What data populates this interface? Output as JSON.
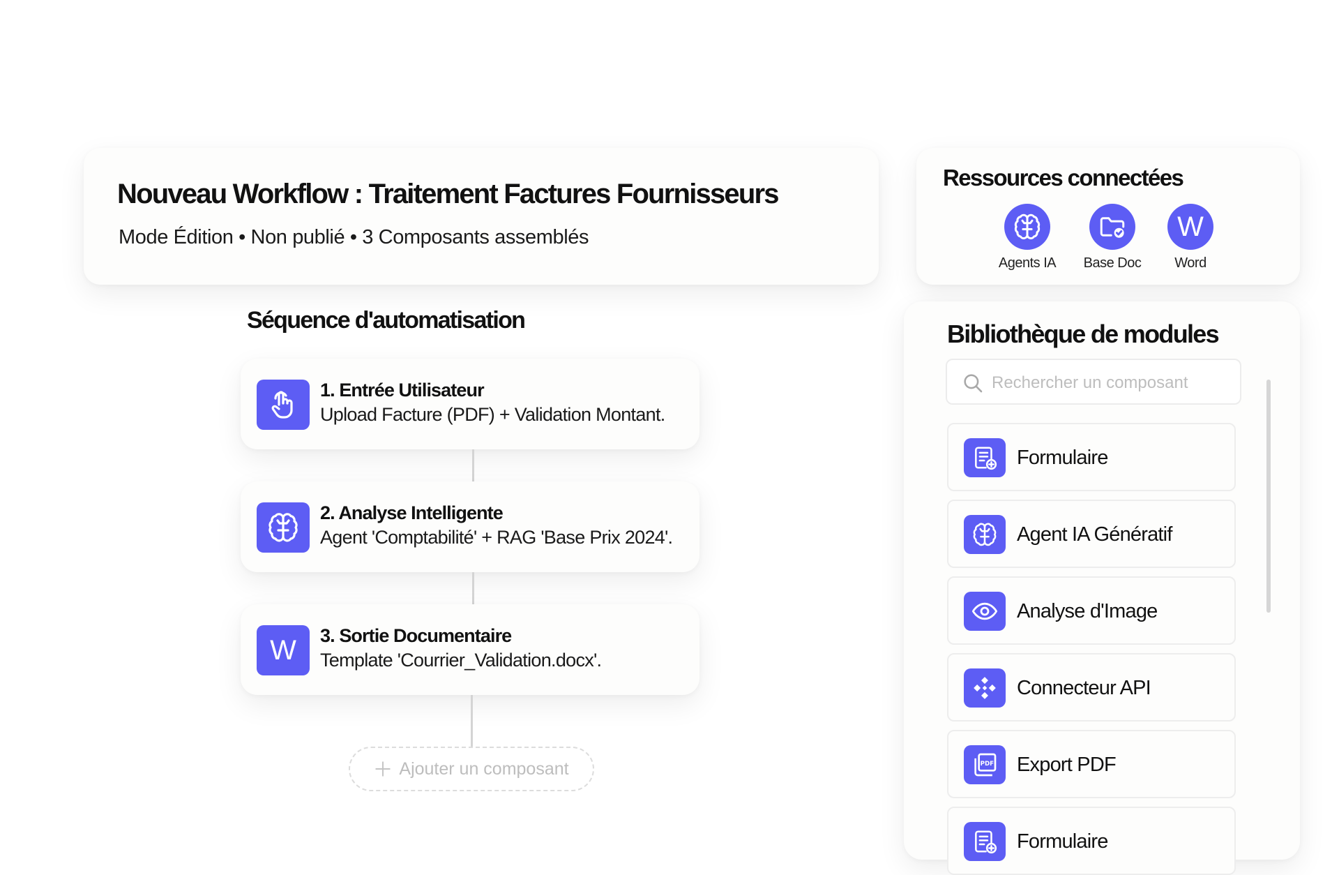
{
  "header": {
    "title": "Nouveau Workflow : Traitement Factures Fournisseurs",
    "subtitle": "Mode Édition • Non publié • 3 Composants assemblés"
  },
  "resources": {
    "title": "Ressources connectées",
    "items": [
      {
        "label": "Agents IA",
        "icon": "brain-icon"
      },
      {
        "label": "Base Doc",
        "icon": "folder-check-icon"
      },
      {
        "label": "Word",
        "icon": "word-icon",
        "glyph": "W"
      }
    ]
  },
  "sequence": {
    "title": "Séquence d'automatisation",
    "steps": [
      {
        "title": "1. Entrée Utilisateur",
        "description": "Upload Facture (PDF) + Validation Montant.",
        "icon": "pointer-hand-icon"
      },
      {
        "title": "2. Analyse Intelligente",
        "description": "Agent 'Comptabilité' + RAG 'Base Prix 2024'.",
        "icon": "brain-icon"
      },
      {
        "title": "3. Sortie Documentaire",
        "description": "Template 'Courrier_Validation.docx'.",
        "icon": "word-icon",
        "glyph": "W"
      }
    ],
    "add_label": "Ajouter un composant"
  },
  "library": {
    "title": "Bibliothèque de modules",
    "search_placeholder": "Rechercher un composant",
    "modules": [
      {
        "label": "Formulaire",
        "icon": "form-add-icon"
      },
      {
        "label": "Agent IA Génératif",
        "icon": "brain-icon"
      },
      {
        "label": "Analyse d'Image",
        "icon": "eye-icon"
      },
      {
        "label": "Connecteur API",
        "icon": "api-connector-icon"
      },
      {
        "label": "Export PDF",
        "icon": "pdf-icon"
      },
      {
        "label": "Formulaire",
        "icon": "form-add-icon"
      }
    ]
  },
  "colors": {
    "accent": "#5d5df4",
    "card": "#fdfdfc",
    "border": "#ededed"
  }
}
